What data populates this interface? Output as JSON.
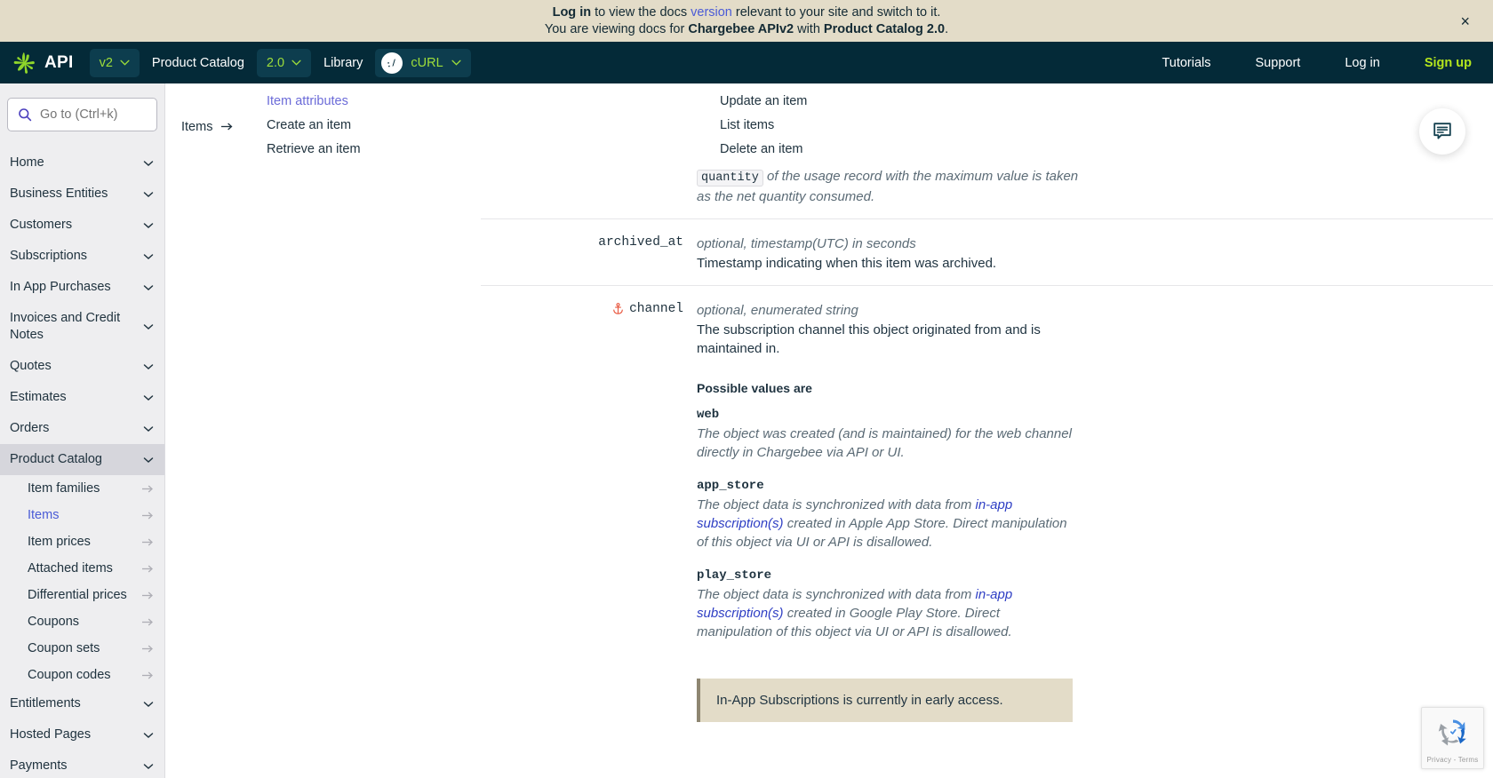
{
  "notice": {
    "line1_prefix": "Log in",
    "line1_mid": " to view the docs ",
    "line1_link": "version",
    "line1_suffix": " relevant to your site and switch to it.",
    "line2_prefix": "You are viewing docs for ",
    "line2_bold1": "Chargebee APIv2",
    "line2_mid": " with ",
    "line2_bold2": "Product Catalog 2.0",
    "line2_suffix": ".",
    "close_label": "×"
  },
  "topnav": {
    "brand": "API",
    "version_pill": "v2",
    "product_catalog_label": "Product Catalog",
    "catalog_pill": "2.0",
    "library_label": "Library",
    "lang_pill": "cURL",
    "right_links": [
      "Tutorials",
      "Support",
      "Log in"
    ],
    "signup": "Sign up",
    "accent_green": "#b5e61d",
    "bar_bg": "#042a38",
    "pill_bg": "#0d3d4e"
  },
  "sidebar": {
    "search_placeholder": "Go to (Ctrl+k)",
    "groups": [
      {
        "label": "Home"
      },
      {
        "label": "Business Entities"
      },
      {
        "label": "Customers"
      },
      {
        "label": "Subscriptions"
      },
      {
        "label": "In App Purchases"
      },
      {
        "label": "Invoices and Credit Notes"
      },
      {
        "label": "Quotes"
      },
      {
        "label": "Estimates"
      },
      {
        "label": "Orders"
      }
    ],
    "active_group": "Product Catalog",
    "sub_items": [
      "Item families",
      "Items",
      "Item prices",
      "Attached items",
      "Differential prices",
      "Coupons",
      "Coupon sets",
      "Coupon codes"
    ],
    "current_sub": "Items",
    "groups_after": [
      {
        "label": "Entitlements"
      },
      {
        "label": "Hosted Pages"
      },
      {
        "label": "Payments"
      }
    ]
  },
  "subnav": {
    "crumb": "Items",
    "col1": [
      "Item attributes",
      "Create an item",
      "Retrieve an item"
    ],
    "col2": [
      "Update an item",
      "List items",
      "Delete an item"
    ],
    "active": "Item attributes"
  },
  "doc": {
    "partial_row": {
      "desc_prefix": "",
      "code": "quantity",
      "desc_rest": " of the usage record with the maximum value is taken as the net quantity consumed."
    },
    "rows": [
      {
        "name": "archived_at",
        "has_anchor": false,
        "type": "optional, timestamp(UTC) in seconds",
        "desc": "Timestamp indicating when this item was archived."
      },
      {
        "name": "channel",
        "has_anchor": true,
        "type": "optional, enumerated string",
        "desc": "The subscription channel this object originated from and is maintained in."
      }
    ],
    "possible_values_title": "Possible values are",
    "possible_values": [
      {
        "key": "web",
        "desc_parts": [
          {
            "text": "The object was created (and is maintained) for the web channel directly in Chargebee via API or UI.",
            "link": false
          }
        ]
      },
      {
        "key": "app_store",
        "desc_parts": [
          {
            "text": "The object data is synchronized with data from ",
            "link": false
          },
          {
            "text": "in-app subscription(s)",
            "link": true
          },
          {
            "text": " created in Apple App Store. Direct manipulation of this object via UI or API is disallowed.",
            "link": false
          }
        ]
      },
      {
        "key": "play_store",
        "desc_parts": [
          {
            "text": "The object data is synchronized with data from ",
            "link": false
          },
          {
            "text": "in-app subscription(s)",
            "link": true
          },
          {
            "text": " created in Google Play Store. Direct manipulation of this object via UI or API is disallowed.",
            "link": false
          }
        ]
      }
    ],
    "callout": "In-App Subscriptions is currently in early access."
  },
  "widgets": {
    "chat_icon": "chat-bubble-icon",
    "recaptcha_label": "Privacy - Terms"
  }
}
